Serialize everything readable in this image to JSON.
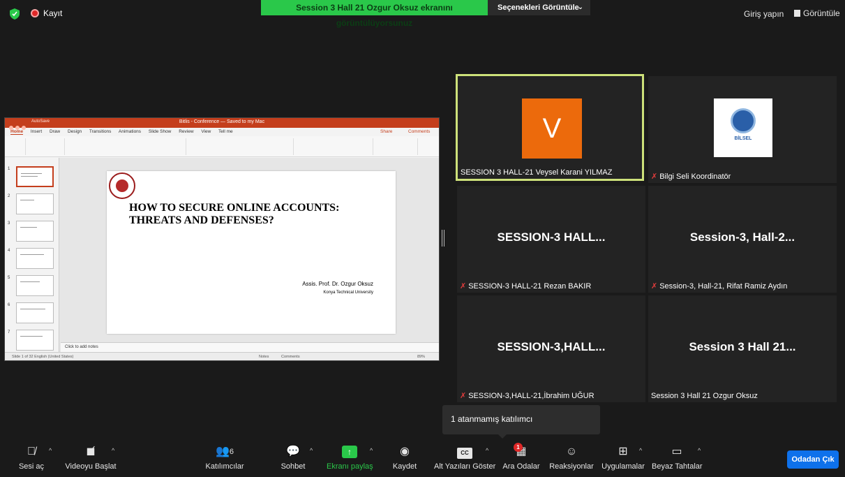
{
  "topbar": {
    "recording_label": "Kayıt",
    "share_banner": "Session 3 Hall 21 Ozgur Oksuz ekranını görüntülüyorsunuz",
    "view_options": "Seçenekleri Görüntüle",
    "signin": "Giriş yapın",
    "view": "Görüntüle",
    "accent": "#2ac84a"
  },
  "shared_screen": {
    "app_title": "Bitlis - Conference — Saved to my Mac",
    "autosave": "AutoSave",
    "tabs": [
      "Home",
      "Insert",
      "Draw",
      "Design",
      "Transitions",
      "Animations",
      "Slide Show",
      "Review",
      "View",
      "Tell me"
    ],
    "share_label": "Share",
    "comments_label": "Comments",
    "slide_numbers": [
      "1",
      "2",
      "3",
      "4",
      "5",
      "6",
      "7"
    ],
    "slide": {
      "title": "HOW TO SECURE ONLINE ACCOUNTS: THREATS AND DEFENSES?",
      "author": "Assis. Prof. Dr. Ozgur Oksuz",
      "university": "Konya Technical University"
    },
    "notes_placeholder": "Click to add notes",
    "status_left": "Slide 1 of 32   English (United States)",
    "status_notes": "Notes",
    "status_comments": "Comments",
    "zoom": "89%"
  },
  "gallery": [
    {
      "name": "SESSION 3 HALL-21 Veysel Karani YILMAZ",
      "avatar_letter": "V",
      "muted": false,
      "active": true,
      "avatar_color": "#ec6a0c"
    },
    {
      "name": "Bilgi Seli Koordinatör",
      "logo_text": "BİLSEL",
      "muted": true,
      "active": false
    },
    {
      "name": "SESSION-3 HALL-21 Rezan BAKIR",
      "display": "SESSION-3  HALL...",
      "muted": true
    },
    {
      "name": "Session-3, Hall-21, Rifat Ramiz Aydın",
      "display": "Session-3,  Hall-2...",
      "muted": true
    },
    {
      "name": "SESSION-3,HALL-21,İbrahim UĞUR",
      "display": "SESSION-3,HALL...",
      "muted": true
    },
    {
      "name": "Session 3 Hall 21 Ozgur Oksuz",
      "display": "Session 3 Hall 21...",
      "muted": false
    }
  ],
  "popup": {
    "text": "1 atanmamış katılımcı"
  },
  "toolbar": {
    "mute": "Sesi aç",
    "video": "Videoyu Başlat",
    "participants": "Katılımcılar",
    "participants_count": "6",
    "chat": "Sohbet",
    "share": "Ekranı paylaş",
    "record": "Kaydet",
    "captions": "Alt Yazıları Göster",
    "captions_icon": "CC",
    "breakout": "Ara Odalar",
    "breakout_badge": "1",
    "reactions": "Reaksiyonlar",
    "apps": "Uygulamalar",
    "whiteboard": "Beyaz Tahtalar",
    "leave": "Odadan Çık",
    "leave_color": "#0e71eb"
  }
}
